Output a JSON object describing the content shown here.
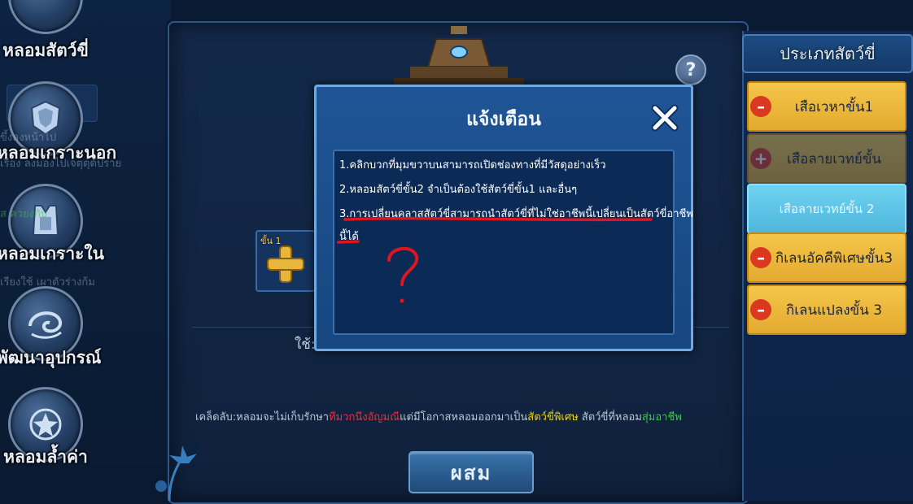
{
  "sidebar": {
    "items": [
      {
        "label": "หลอมสัตว์ขี่"
      },
      {
        "label": "หลอมเกราะนอก"
      },
      {
        "label": "หลอมเกราะใน"
      },
      {
        "label": "พัฒนาอุปกรณ์"
      },
      {
        "label": "หลอมล้ำค่า"
      }
    ]
  },
  "main": {
    "slot_level": "ขั้น 1",
    "use_label": "ใช้:",
    "tip": {
      "prefix": "เคล็ดลับ:หลอมจะไม่เก็บรักษา",
      "red": "ทีมวกนึงอัญมณี",
      "middle": "แต่มีโอกาสหลอมออกมาเป็น",
      "yellow": "สัตว์ขี่พิเศษ",
      "middle2": " สัตว์ขี่ที่หลอม",
      "green": "สุ่มอาชีพ"
    },
    "combine_label": "ผสม",
    "help_label": "?"
  },
  "right_panel": {
    "title": "ประเภทสัตว์ขี่",
    "mounts": [
      {
        "label": "เสือเวหาขั้น1",
        "tag": "–"
      },
      {
        "label": "เสือลายเวทย์ขั้น",
        "tag": "+"
      },
      {
        "label": "เสือลายเวทย์ขั้น 2"
      },
      {
        "label": "กิเลนอัคคีพิเศษขั้น3",
        "tag": "–"
      },
      {
        "label": "กิเลนแปลงขั้น 3",
        "tag": "–"
      }
    ]
  },
  "dialog": {
    "title": "แจ้งเตือน",
    "lines": [
      "1.คลิกบวกที่มุมขวาบนสามารถเปิดช่องทางที่มีวัสดุอย่างเร็ว",
      "2.หลอมสัตว์ขี่ขั้น2 จำเป็นต้องใช้สัตว์ขี่ขั้น1 และอื่นๆ",
      "3.การเปลี่ยนคลาสสัตว์ขี่สามารถนำสัตว์ขี่ที่ไม่ใช่อาชีพนี้เปลี่ยนเป็นสัตว์ขี่อาชีพ",
      "นี้ได้"
    ],
    "annotation": "?"
  },
  "colors": {
    "accent_red": "#e3333f",
    "accent_yellow": "#e8d02d",
    "accent_green": "#3cc84c",
    "mount_gold": "#f4c64a",
    "mount_selected": "#6fd2f1"
  }
}
